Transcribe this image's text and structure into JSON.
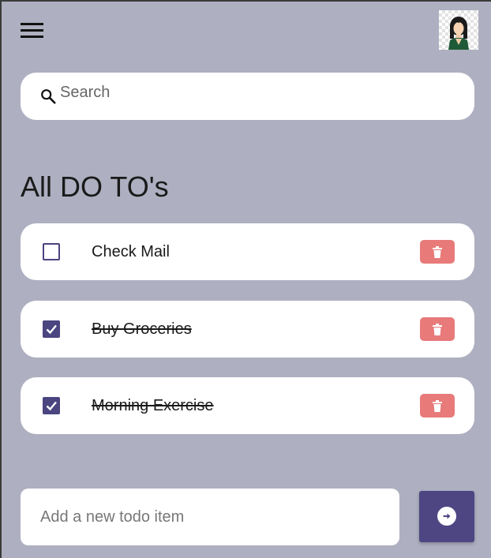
{
  "header": {
    "menu_icon": "hamburger-menu-icon",
    "avatar_icon": "user-avatar"
  },
  "search": {
    "placeholder": "Search",
    "icon": "search-icon"
  },
  "section_title": "All DO TO's",
  "todos": [
    {
      "label": "Check Mail",
      "checked": false
    },
    {
      "label": "Buy Groceries",
      "checked": true
    },
    {
      "label": "Morning Exercise",
      "checked": true
    }
  ],
  "new_todo": {
    "placeholder": "Add a new todo item"
  },
  "colors": {
    "background": "#aeb0c1",
    "accent": "#4b4580",
    "delete": "#e87a7a"
  }
}
